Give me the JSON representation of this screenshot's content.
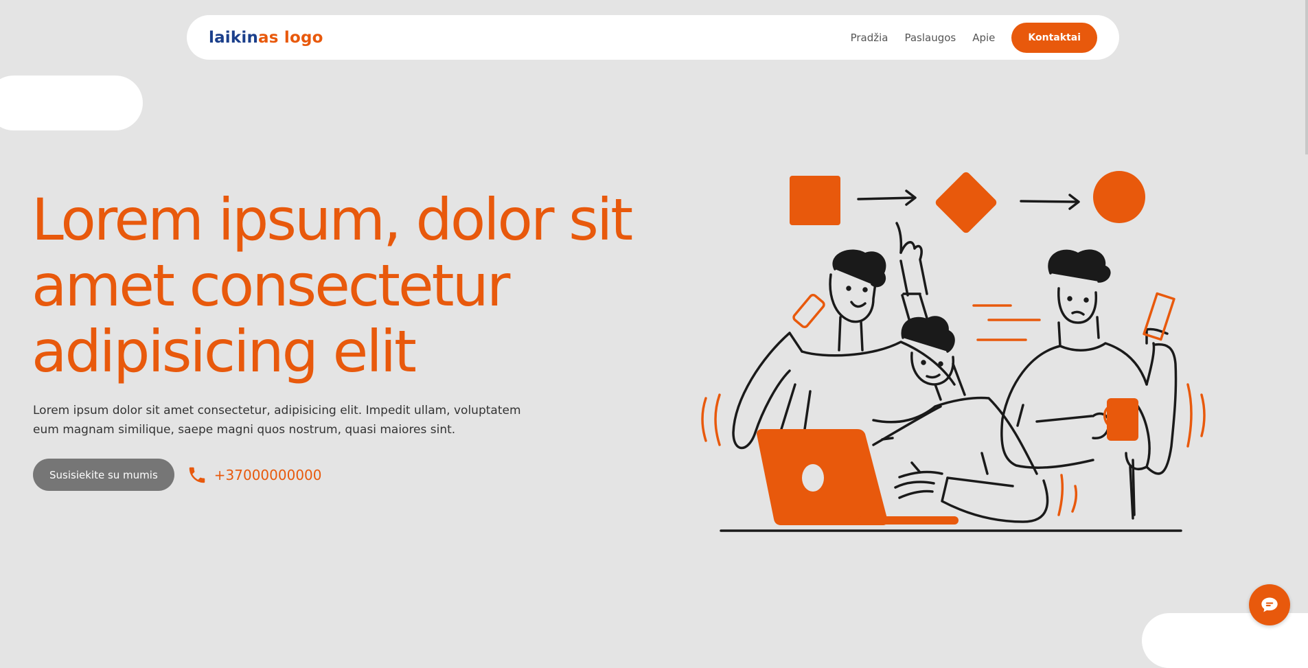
{
  "colors": {
    "accent": "#e8590c",
    "logo_blue": "#1b3f8b",
    "background": "#e4e4e4",
    "button_gray": "#767676"
  },
  "header": {
    "logo": {
      "part1": "laikin",
      "part2": "as logo"
    },
    "nav": [
      {
        "label": "Pradžia"
      },
      {
        "label": "Paslaugos"
      },
      {
        "label": "Apie"
      }
    ],
    "cta_label": "Kontaktai"
  },
  "hero": {
    "title": "Lorem ipsum, dolor sit amet consectetur adipisicing elit",
    "description": "Lorem ipsum dolor sit amet consectetur, adipisicing elit. Impedit ullam, voluptatem eum magnam similique, saepe magni quos nostrum, quasi maiores sint.",
    "contact_button_label": "Susisiekite su mumis",
    "phone_icon": "phone-icon",
    "phone_number": "+37000000000"
  },
  "illustration": {
    "icon": "team-collaboration-illustration"
  },
  "chat_widget": {
    "icon": "chat-icon"
  }
}
